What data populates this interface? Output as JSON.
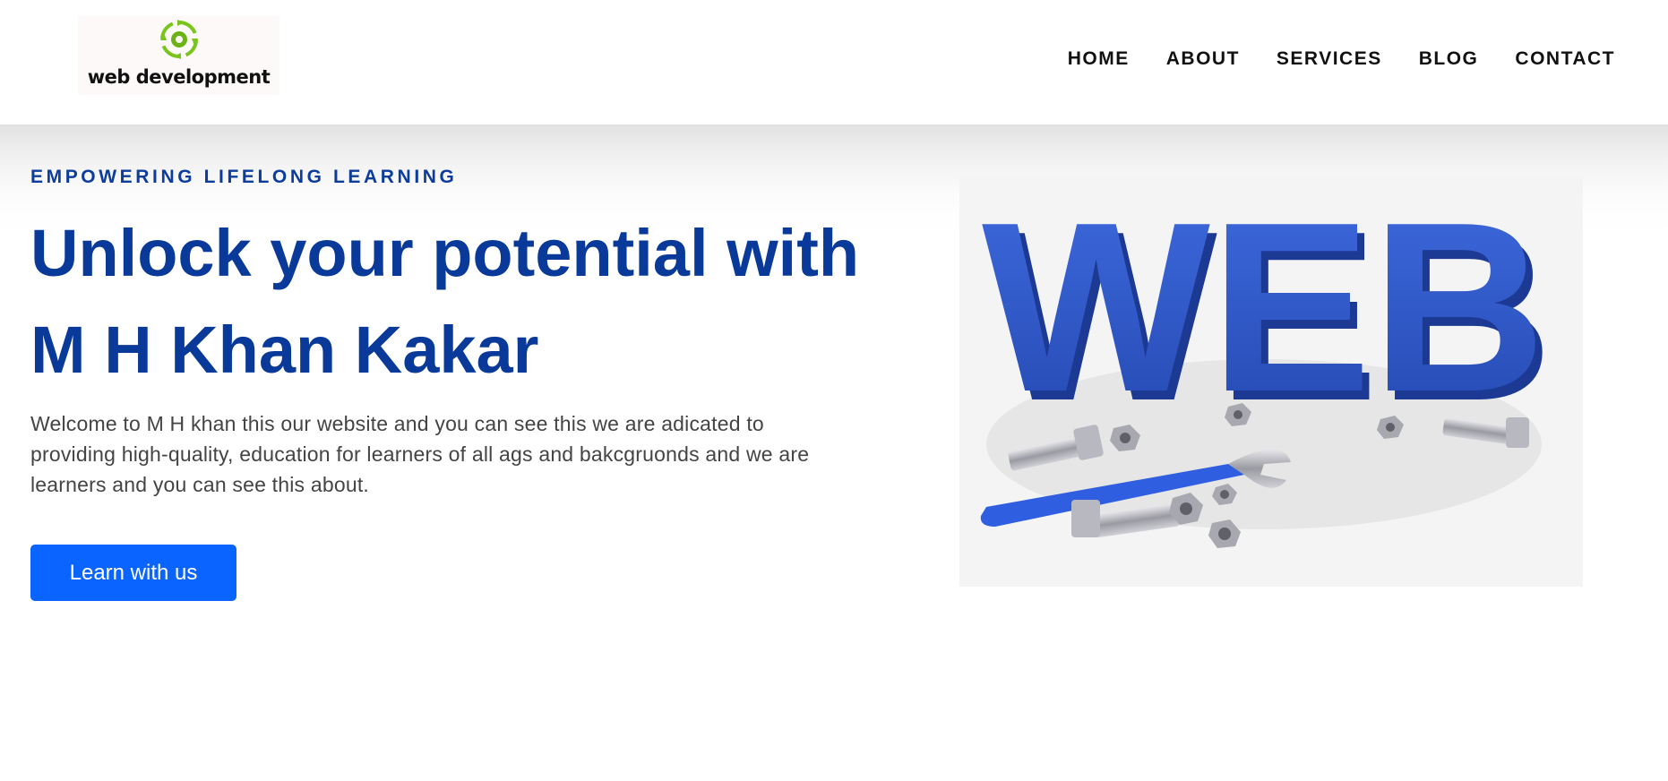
{
  "header": {
    "logo_text": "web development",
    "nav": [
      "HOME",
      "ABOUT",
      "SERVICES",
      "BLOG",
      "CONTACT"
    ]
  },
  "hero": {
    "eyebrow": "EMPOWERING LIFELONG LEARNING",
    "headline": "Unlock your potential with M H Khan Kakar",
    "description": "Welcome to M H khan this our website and you can see this we are adicated to providing high-quality, education for learners of all ags and bakcgruonds and we are learners and you can see this about.",
    "cta_label": "Learn with us",
    "image_text": "WEB"
  },
  "colors": {
    "primary": "#0a3a99",
    "button": "#0a64ff",
    "logo_green": "#7ac51c",
    "web_blue": "#2d56c8"
  },
  "icons": [
    "gear-recycle-logo-icon"
  ]
}
